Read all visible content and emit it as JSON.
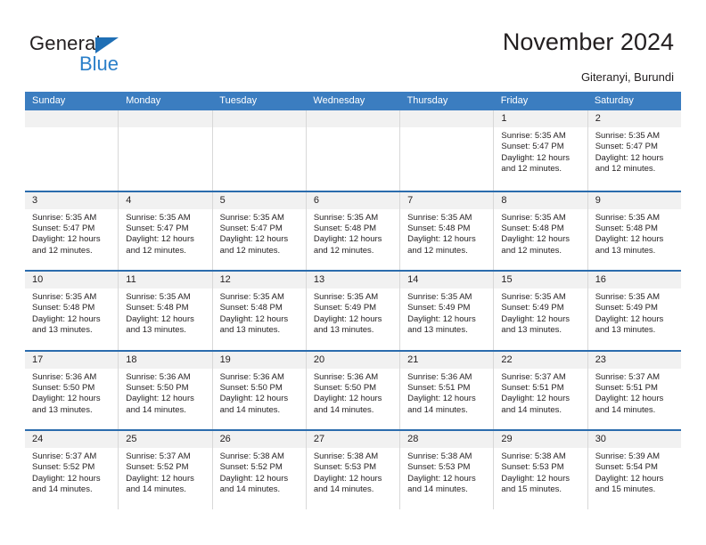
{
  "brand": {
    "name_top": "General",
    "name_bottom": "Blue",
    "accent_color": "#2a7fc9",
    "triangle_color": "#1f6fb5"
  },
  "header": {
    "title": "November 2024",
    "location": "Giteranyi, Burundi"
  },
  "calendar": {
    "header_bg": "#3b7dc0",
    "row_divider": "#2b6cad",
    "daynum_bg": "#f1f1f1",
    "weekdays": [
      "Sunday",
      "Monday",
      "Tuesday",
      "Wednesday",
      "Thursday",
      "Friday",
      "Saturday"
    ],
    "weeks": [
      [
        {
          "day": "",
          "sunrise": "",
          "sunset": "",
          "daylight_1": "",
          "daylight_2": ""
        },
        {
          "day": "",
          "sunrise": "",
          "sunset": "",
          "daylight_1": "",
          "daylight_2": ""
        },
        {
          "day": "",
          "sunrise": "",
          "sunset": "",
          "daylight_1": "",
          "daylight_2": ""
        },
        {
          "day": "",
          "sunrise": "",
          "sunset": "",
          "daylight_1": "",
          "daylight_2": ""
        },
        {
          "day": "",
          "sunrise": "",
          "sunset": "",
          "daylight_1": "",
          "daylight_2": ""
        },
        {
          "day": "1",
          "sunrise": "Sunrise: 5:35 AM",
          "sunset": "Sunset: 5:47 PM",
          "daylight_1": "Daylight: 12 hours",
          "daylight_2": "and 12 minutes."
        },
        {
          "day": "2",
          "sunrise": "Sunrise: 5:35 AM",
          "sunset": "Sunset: 5:47 PM",
          "daylight_1": "Daylight: 12 hours",
          "daylight_2": "and 12 minutes."
        }
      ],
      [
        {
          "day": "3",
          "sunrise": "Sunrise: 5:35 AM",
          "sunset": "Sunset: 5:47 PM",
          "daylight_1": "Daylight: 12 hours",
          "daylight_2": "and 12 minutes."
        },
        {
          "day": "4",
          "sunrise": "Sunrise: 5:35 AM",
          "sunset": "Sunset: 5:47 PM",
          "daylight_1": "Daylight: 12 hours",
          "daylight_2": "and 12 minutes."
        },
        {
          "day": "5",
          "sunrise": "Sunrise: 5:35 AM",
          "sunset": "Sunset: 5:47 PM",
          "daylight_1": "Daylight: 12 hours",
          "daylight_2": "and 12 minutes."
        },
        {
          "day": "6",
          "sunrise": "Sunrise: 5:35 AM",
          "sunset": "Sunset: 5:48 PM",
          "daylight_1": "Daylight: 12 hours",
          "daylight_2": "and 12 minutes."
        },
        {
          "day": "7",
          "sunrise": "Sunrise: 5:35 AM",
          "sunset": "Sunset: 5:48 PM",
          "daylight_1": "Daylight: 12 hours",
          "daylight_2": "and 12 minutes."
        },
        {
          "day": "8",
          "sunrise": "Sunrise: 5:35 AM",
          "sunset": "Sunset: 5:48 PM",
          "daylight_1": "Daylight: 12 hours",
          "daylight_2": "and 12 minutes."
        },
        {
          "day": "9",
          "sunrise": "Sunrise: 5:35 AM",
          "sunset": "Sunset: 5:48 PM",
          "daylight_1": "Daylight: 12 hours",
          "daylight_2": "and 13 minutes."
        }
      ],
      [
        {
          "day": "10",
          "sunrise": "Sunrise: 5:35 AM",
          "sunset": "Sunset: 5:48 PM",
          "daylight_1": "Daylight: 12 hours",
          "daylight_2": "and 13 minutes."
        },
        {
          "day": "11",
          "sunrise": "Sunrise: 5:35 AM",
          "sunset": "Sunset: 5:48 PM",
          "daylight_1": "Daylight: 12 hours",
          "daylight_2": "and 13 minutes."
        },
        {
          "day": "12",
          "sunrise": "Sunrise: 5:35 AM",
          "sunset": "Sunset: 5:48 PM",
          "daylight_1": "Daylight: 12 hours",
          "daylight_2": "and 13 minutes."
        },
        {
          "day": "13",
          "sunrise": "Sunrise: 5:35 AM",
          "sunset": "Sunset: 5:49 PM",
          "daylight_1": "Daylight: 12 hours",
          "daylight_2": "and 13 minutes."
        },
        {
          "day": "14",
          "sunrise": "Sunrise: 5:35 AM",
          "sunset": "Sunset: 5:49 PM",
          "daylight_1": "Daylight: 12 hours",
          "daylight_2": "and 13 minutes."
        },
        {
          "day": "15",
          "sunrise": "Sunrise: 5:35 AM",
          "sunset": "Sunset: 5:49 PM",
          "daylight_1": "Daylight: 12 hours",
          "daylight_2": "and 13 minutes."
        },
        {
          "day": "16",
          "sunrise": "Sunrise: 5:35 AM",
          "sunset": "Sunset: 5:49 PM",
          "daylight_1": "Daylight: 12 hours",
          "daylight_2": "and 13 minutes."
        }
      ],
      [
        {
          "day": "17",
          "sunrise": "Sunrise: 5:36 AM",
          "sunset": "Sunset: 5:50 PM",
          "daylight_1": "Daylight: 12 hours",
          "daylight_2": "and 13 minutes."
        },
        {
          "day": "18",
          "sunrise": "Sunrise: 5:36 AM",
          "sunset": "Sunset: 5:50 PM",
          "daylight_1": "Daylight: 12 hours",
          "daylight_2": "and 14 minutes."
        },
        {
          "day": "19",
          "sunrise": "Sunrise: 5:36 AM",
          "sunset": "Sunset: 5:50 PM",
          "daylight_1": "Daylight: 12 hours",
          "daylight_2": "and 14 minutes."
        },
        {
          "day": "20",
          "sunrise": "Sunrise: 5:36 AM",
          "sunset": "Sunset: 5:50 PM",
          "daylight_1": "Daylight: 12 hours",
          "daylight_2": "and 14 minutes."
        },
        {
          "day": "21",
          "sunrise": "Sunrise: 5:36 AM",
          "sunset": "Sunset: 5:51 PM",
          "daylight_1": "Daylight: 12 hours",
          "daylight_2": "and 14 minutes."
        },
        {
          "day": "22",
          "sunrise": "Sunrise: 5:37 AM",
          "sunset": "Sunset: 5:51 PM",
          "daylight_1": "Daylight: 12 hours",
          "daylight_2": "and 14 minutes."
        },
        {
          "day": "23",
          "sunrise": "Sunrise: 5:37 AM",
          "sunset": "Sunset: 5:51 PM",
          "daylight_1": "Daylight: 12 hours",
          "daylight_2": "and 14 minutes."
        }
      ],
      [
        {
          "day": "24",
          "sunrise": "Sunrise: 5:37 AM",
          "sunset": "Sunset: 5:52 PM",
          "daylight_1": "Daylight: 12 hours",
          "daylight_2": "and 14 minutes."
        },
        {
          "day": "25",
          "sunrise": "Sunrise: 5:37 AM",
          "sunset": "Sunset: 5:52 PM",
          "daylight_1": "Daylight: 12 hours",
          "daylight_2": "and 14 minutes."
        },
        {
          "day": "26",
          "sunrise": "Sunrise: 5:38 AM",
          "sunset": "Sunset: 5:52 PM",
          "daylight_1": "Daylight: 12 hours",
          "daylight_2": "and 14 minutes."
        },
        {
          "day": "27",
          "sunrise": "Sunrise: 5:38 AM",
          "sunset": "Sunset: 5:53 PM",
          "daylight_1": "Daylight: 12 hours",
          "daylight_2": "and 14 minutes."
        },
        {
          "day": "28",
          "sunrise": "Sunrise: 5:38 AM",
          "sunset": "Sunset: 5:53 PM",
          "daylight_1": "Daylight: 12 hours",
          "daylight_2": "and 14 minutes."
        },
        {
          "day": "29",
          "sunrise": "Sunrise: 5:38 AM",
          "sunset": "Sunset: 5:53 PM",
          "daylight_1": "Daylight: 12 hours",
          "daylight_2": "and 15 minutes."
        },
        {
          "day": "30",
          "sunrise": "Sunrise: 5:39 AM",
          "sunset": "Sunset: 5:54 PM",
          "daylight_1": "Daylight: 12 hours",
          "daylight_2": "and 15 minutes."
        }
      ]
    ]
  }
}
